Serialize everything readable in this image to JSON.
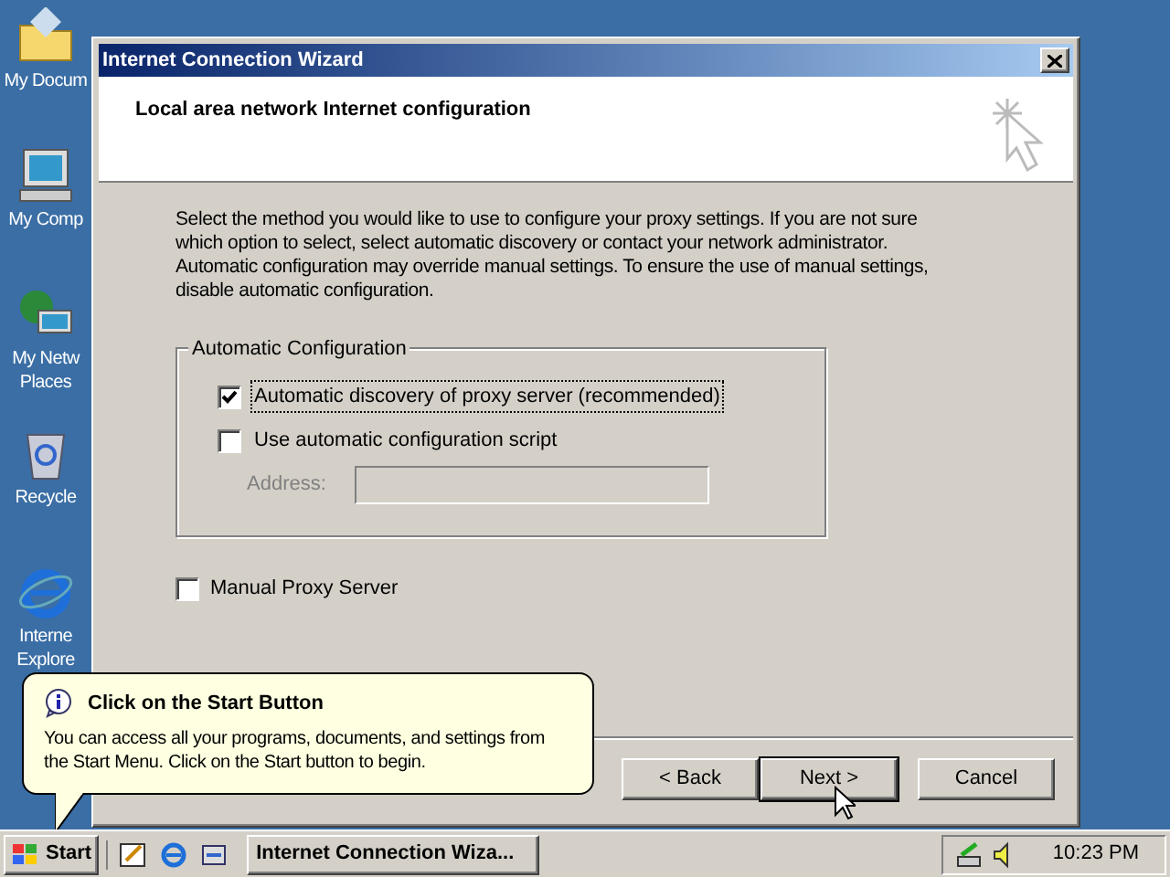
{
  "desktop_icons": [
    {
      "kind": "documents",
      "lines": [
        "My Docum"
      ]
    },
    {
      "kind": "computer",
      "lines": [
        "My Comp"
      ]
    },
    {
      "kind": "network",
      "lines": [
        "My Netw",
        "Places"
      ]
    },
    {
      "kind": "recycle",
      "lines": [
        "Recycle"
      ]
    },
    {
      "kind": "browser",
      "lines": [
        "Interne",
        "Explore"
      ]
    }
  ],
  "window": {
    "title": "Internet Connection Wizard",
    "header": "Local area network Internet configuration",
    "intro": "Select the method you would like to use to configure your proxy settings.  If you are not sure which option to select, select automatic discovery or contact your network administrator.  Automatic configuration may override manual settings.  To ensure the use of manual settings, disable automatic configuration.",
    "group": {
      "title": "Automatic Configuration",
      "options": [
        {
          "label": "Automatic discovery of proxy server (recommended)",
          "checked": true,
          "focused": true
        },
        {
          "label": "Use automatic configuration script",
          "checked": false,
          "focused": false
        }
      ],
      "address": {
        "label": "Address:",
        "disabled": true
      }
    },
    "manual": {
      "label": "Manual Proxy Server",
      "checked": false
    },
    "buttons": [
      {
        "label": "< Back",
        "default": false
      },
      {
        "label": "Next >",
        "default": true
      },
      {
        "label": "Cancel",
        "default": false
      }
    ]
  },
  "balloon": {
    "title": "Click on the Start Button",
    "text": "You can access all your programs, documents, and settings from the Start Menu. Click on the Start button to begin."
  },
  "taskbar": {
    "start": "Start",
    "quick_launch": [
      {
        "kind": "desktop"
      },
      {
        "kind": "browser"
      },
      {
        "kind": "channels"
      }
    ],
    "tasks": [
      {
        "label": "Internet Connection Wiza...",
        "selected": false
      }
    ],
    "clock": "10:23 PM"
  }
}
